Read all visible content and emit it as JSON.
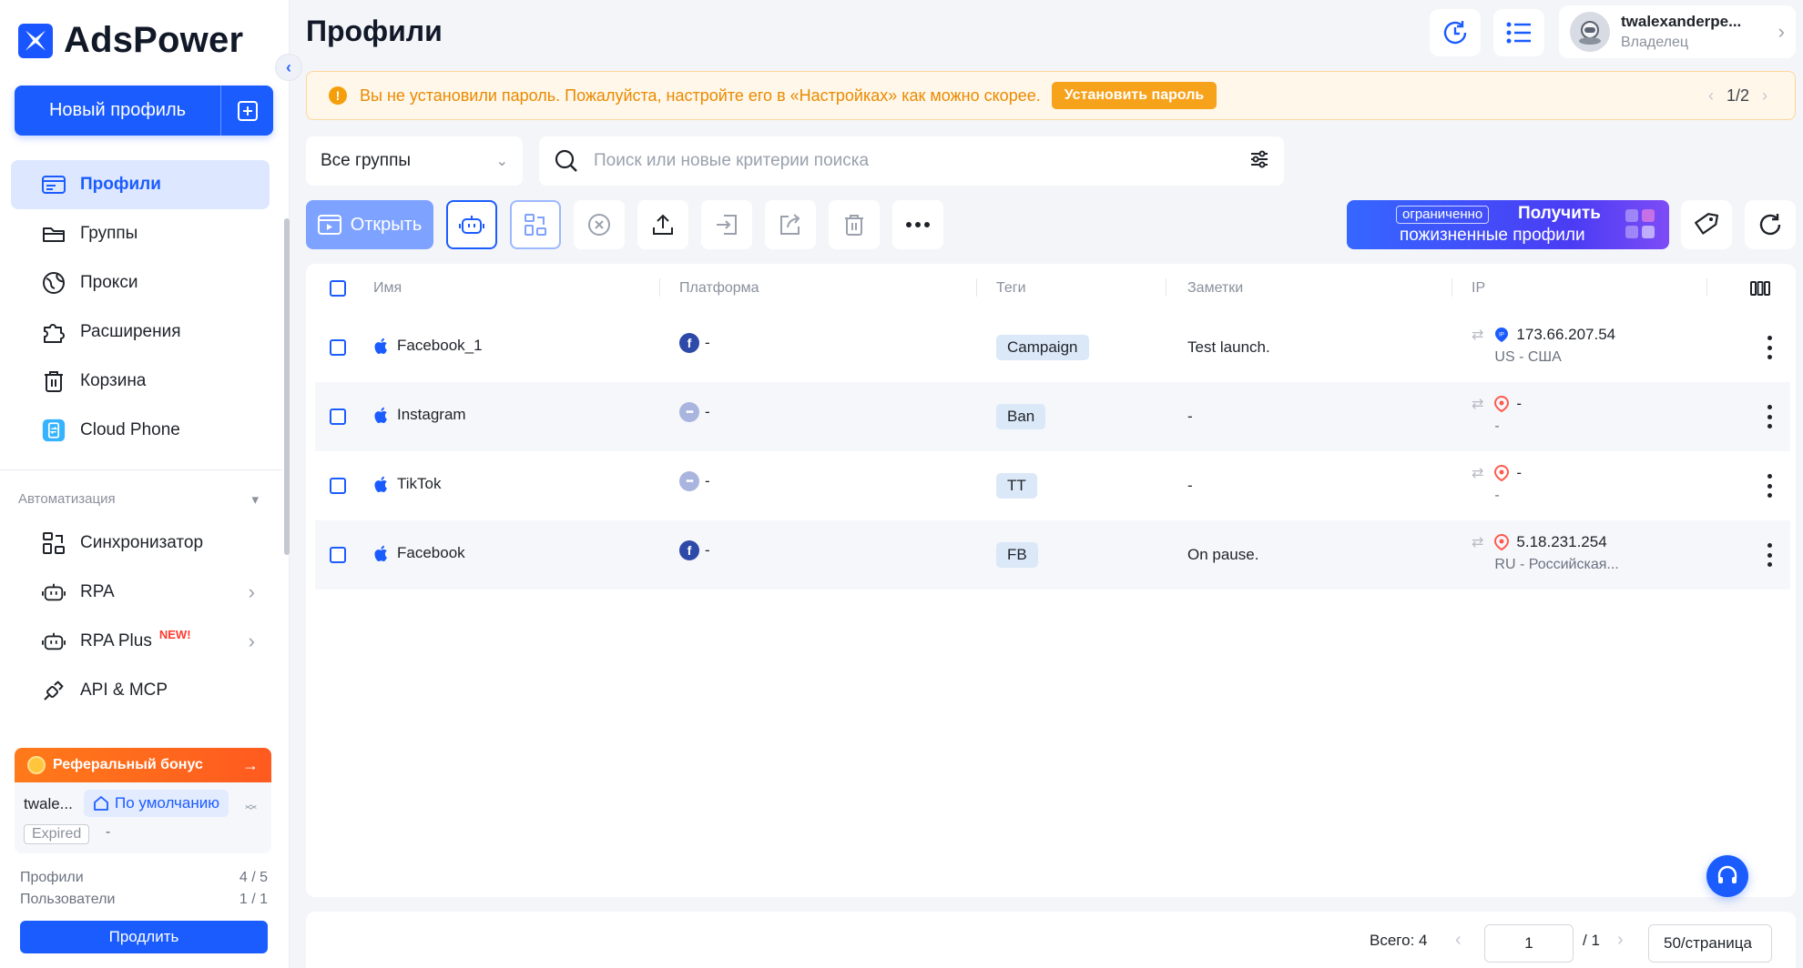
{
  "app": {
    "name": "AdsPower"
  },
  "sidebar": {
    "new_profile_label": "Новый профиль",
    "nav": [
      {
        "label": "Профили",
        "icon": "profiles-icon",
        "active": true
      },
      {
        "label": "Группы",
        "icon": "folder-icon"
      },
      {
        "label": "Прокси",
        "icon": "globe-icon"
      },
      {
        "label": "Расширения",
        "icon": "puzzle-icon"
      },
      {
        "label": "Корзина",
        "icon": "trash-icon"
      },
      {
        "label": "Cloud Phone",
        "icon": "cloud-phone-icon"
      }
    ],
    "automation_label": "Автоматизация",
    "automation": [
      {
        "label": "Синхронизатор",
        "icon": "sync-icon"
      },
      {
        "label": "RPA",
        "icon": "robot-icon"
      },
      {
        "label": "RPA Plus",
        "icon": "robot-icon",
        "badge": "NEW!"
      },
      {
        "label": "API & MCP",
        "icon": "plug-icon"
      }
    ],
    "referral_label": "Реферальный бонус",
    "account": {
      "name": "twale...",
      "workspace": "По умолчанию",
      "status": "Expired",
      "status_extra": "-",
      "profiles_label": "Профили",
      "profiles_value": "4 / 5",
      "users_label": "Пользователи",
      "users_value": "1 / 1",
      "extend_label": "Продлить"
    }
  },
  "header": {
    "title": "Профили",
    "user_name": "twalexanderpe...",
    "user_role": "Владелец"
  },
  "warning": {
    "text": "Вы не установили пароль. Пожалуйста, настройте его в «Настройках» как можно скорее.",
    "button": "Установить пароль",
    "pager": "1/2"
  },
  "filters": {
    "group": "Все группы",
    "search_placeholder": "Поиск или новые критерии поиска"
  },
  "toolbar": {
    "open_label": "Открыть",
    "promo_tag": "ограниченно",
    "promo_line1": "Получить",
    "promo_line2": "пожизненные профили"
  },
  "table": {
    "headers": {
      "name": "Имя",
      "platform": "Платформа",
      "tags": "Теги",
      "notes": "Заметки",
      "ip": "IP"
    },
    "rows": [
      {
        "name": "Facebook_1",
        "platform_icon": "facebook-icon",
        "platform": "-",
        "tag": "Campaign",
        "notes": "Test launch.",
        "ip": "173.66.207.54",
        "ip_location": "US - США",
        "ip_icon": "ip-pin-blue"
      },
      {
        "name": "Instagram",
        "platform_icon": "other-platform-icon",
        "platform": "-",
        "tag": "Ban",
        "notes": "-",
        "ip": "-",
        "ip_location": "-",
        "ip_icon": "ip-pin-red"
      },
      {
        "name": "TikTok",
        "platform_icon": "other-platform-icon",
        "platform": "-",
        "tag": "TT",
        "notes": "-",
        "ip": "-",
        "ip_location": "-",
        "ip_icon": "ip-pin-red"
      },
      {
        "name": "Facebook",
        "platform_icon": "facebook-icon",
        "platform": "-",
        "tag": "FB",
        "notes": "On pause.",
        "ip": "5.18.231.254",
        "ip_location": "RU - Российская...",
        "ip_icon": "ip-pin-red"
      }
    ]
  },
  "footer": {
    "total": "Всего: 4",
    "page": "1",
    "page_total": "/ 1",
    "page_size": "50/страница"
  },
  "colors": {
    "accent": "#1b5cff",
    "warning": "#f7a21b",
    "referral": "#ff6a1f"
  }
}
